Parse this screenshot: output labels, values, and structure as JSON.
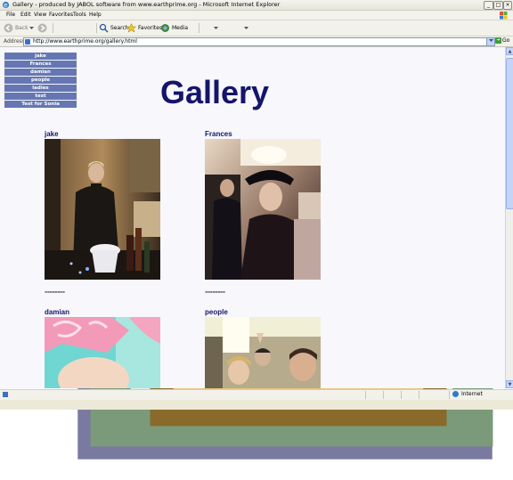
{
  "window": {
    "title": "Gallery - produced by JABOL software from www.earthprime.org - Microsoft Internet Explorer",
    "minimize": "_",
    "maximize": "□",
    "close": "×"
  },
  "menu": [
    "File",
    "Edit",
    "View",
    "Favorites",
    "Tools",
    "Help"
  ],
  "toolbar": {
    "back": "Back",
    "search": "Search",
    "favorites": "Favorites",
    "media": "Media"
  },
  "address": {
    "label": "Address",
    "url": "http://www.earthprime.org/gallery.html",
    "go": "Go"
  },
  "page": {
    "title": "Gallery",
    "nav": [
      "jake",
      "Frances",
      "damian",
      "people",
      "ladies",
      "test",
      "Test for Sonia"
    ],
    "galleries": [
      {
        "label": "jake",
        "after": "--------"
      },
      {
        "label": "Frances",
        "after": "--------"
      },
      {
        "label": "damian"
      },
      {
        "label": "people"
      }
    ]
  },
  "status": {
    "zone": "Internet"
  },
  "colors": {
    "nav_bg": "#6577b3",
    "title": "#15156b",
    "page_bg": "#f7f7fc"
  }
}
